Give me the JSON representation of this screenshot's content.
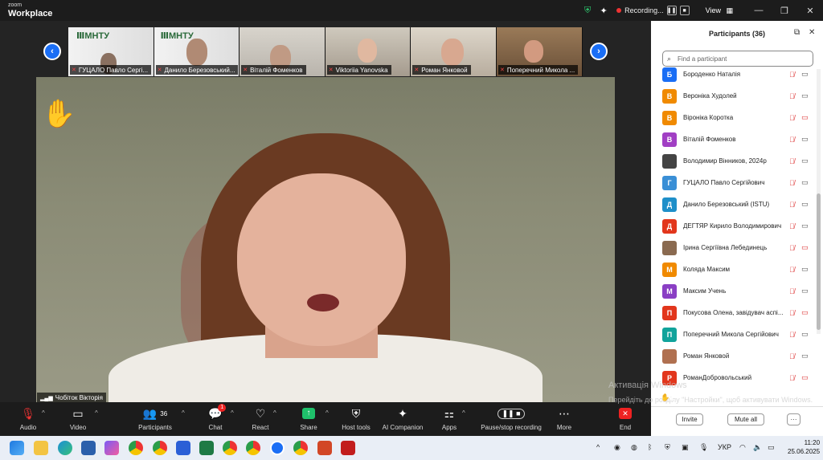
{
  "app": {
    "brand_top": "zoom",
    "brand_bottom": "Workplace"
  },
  "titlebar": {
    "recording_label": "Recording...",
    "view_label": "View"
  },
  "thumbnails": [
    {
      "name": "ГУЦАЛО Павло Сергі..."
    },
    {
      "name": "Данило Березовський..."
    },
    {
      "name": "Віталій Фоменков"
    },
    {
      "name": "Viktoriia Yanovska"
    },
    {
      "name": "Роман Янковой"
    },
    {
      "name": "Поперечний Микола ..."
    }
  ],
  "main_video": {
    "speaker_name": "Чобіток Вікторія"
  },
  "toolbar": {
    "audio": "Audio",
    "video": "Video",
    "participants": "Participants",
    "participants_count": "36",
    "chat": "Chat",
    "chat_badge": "1",
    "react": "React",
    "share": "Share",
    "host_tools": "Host tools",
    "ai": "AI Companion",
    "apps": "Apps",
    "pause": "Pause/stop recording",
    "more": "More",
    "end": "End"
  },
  "panel": {
    "title": "Participants (36)",
    "search_placeholder": "Find a participant",
    "participants": [
      {
        "initial": "Б",
        "color": "#1a6ef5",
        "name": "Бороденко Наталія",
        "video_off": false
      },
      {
        "initial": "В",
        "color": "#f08a00",
        "name": "Вероніка Худолей",
        "video_off": false
      },
      {
        "initial": "В",
        "color": "#f08a00",
        "name": "Віроніка Коротка",
        "video_off": true
      },
      {
        "initial": "В",
        "color": "#a13fc4",
        "name": "Віталій Фоменков",
        "video_off": false
      },
      {
        "initial": "",
        "color": "#444444",
        "name": "Володимир Вінников, 2024р",
        "video_off": false
      },
      {
        "initial": "Г",
        "color": "#3a8fd6",
        "name": "ГУЦАЛО Павло Сергійович",
        "video_off": false
      },
      {
        "initial": "Д",
        "color": "#1e8fc9",
        "name": "Данило Березовський (ISTU)",
        "video_off": false
      },
      {
        "initial": "Д",
        "color": "#e2361c",
        "name": "ДЕГТЯР Кирило Володимирович",
        "video_off": false
      },
      {
        "initial": "",
        "color": "#8a6a50",
        "name": "Ірина Сергіївна Лебединець",
        "video_off": true
      },
      {
        "initial": "М",
        "color": "#f08a00",
        "name": "Коляда Максим",
        "video_off": false
      },
      {
        "initial": "М",
        "color": "#8a3fc4",
        "name": "Максим Учень",
        "video_off": false
      },
      {
        "initial": "П",
        "color": "#e2361c",
        "name": "Покусова Олена, завідувач аспі...",
        "video_off": true
      },
      {
        "initial": "П",
        "color": "#11a39b",
        "name": "Поперечний Микола Сергійович",
        "video_off": false
      },
      {
        "initial": "",
        "color": "#b07050",
        "name": "Роман Янковой",
        "video_off": false
      },
      {
        "initial": "Р",
        "color": "#e2361c",
        "name": "РоманДобровольський",
        "video_off": true
      }
    ],
    "invite": "Invite",
    "mute_all": "Mute all",
    "more": "···"
  },
  "activation": {
    "line1": "Активація Windows",
    "line2": "Перейдіть до розділу \"Настройки\", щоб активувати Windows."
  },
  "reaction": {
    "count": "2"
  },
  "taskbar": {
    "lang": "УКР",
    "time": "11:20",
    "date": "25.06.2025"
  }
}
